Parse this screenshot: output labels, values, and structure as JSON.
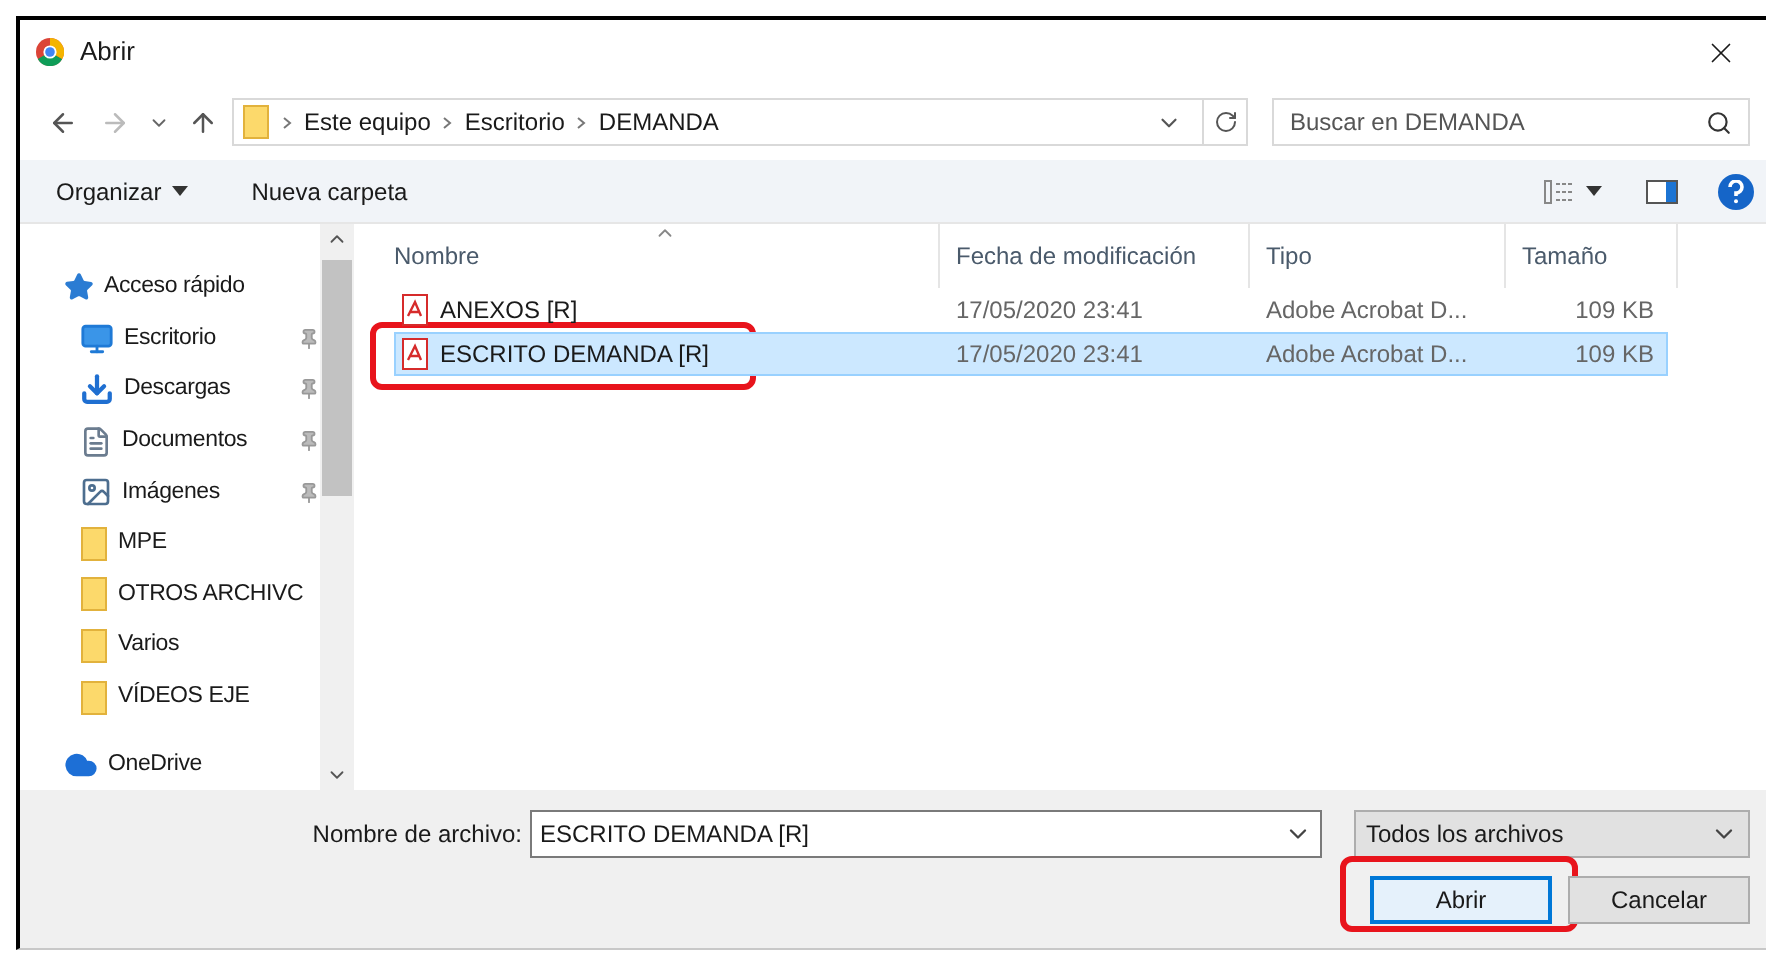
{
  "window": {
    "title": "Abrir"
  },
  "address_bar": {
    "path": [
      "Este equipo",
      "Escritorio",
      "DEMANDA"
    ]
  },
  "search": {
    "placeholder": "Buscar en DEMANDA"
  },
  "toolbar": {
    "organize": "Organizar",
    "new_folder": "Nueva carpeta"
  },
  "sidebar": {
    "items": [
      {
        "label": "Acceso rápido",
        "kind": "star",
        "pinned": false
      },
      {
        "label": "Escritorio",
        "kind": "desktop",
        "pinned": true
      },
      {
        "label": "Descargas",
        "kind": "download",
        "pinned": true
      },
      {
        "label": "Documentos",
        "kind": "document",
        "pinned": true
      },
      {
        "label": "Imágenes",
        "kind": "image",
        "pinned": true
      },
      {
        "label": "MPE",
        "kind": "folder",
        "pinned": false
      },
      {
        "label": "OTROS ARCHIVC",
        "kind": "folder",
        "pinned": false
      },
      {
        "label": "Varios",
        "kind": "folder",
        "pinned": false
      },
      {
        "label": "VÍDEOS EJE",
        "kind": "folder",
        "pinned": false
      },
      {
        "label": "OneDrive",
        "kind": "cloud",
        "pinned": false
      }
    ]
  },
  "table": {
    "columns": [
      "Nombre",
      "Fecha de modificación",
      "Tipo",
      "Tamaño"
    ],
    "rows": [
      {
        "name": "ANEXOS [R]",
        "date": "17/05/2020 23:41",
        "type": "Adobe Acrobat D...",
        "size": "109 KB",
        "selected": false,
        "highlighted": false
      },
      {
        "name": "ESCRITO DEMANDA [R]",
        "date": "17/05/2020 23:41",
        "type": "Adobe Acrobat D...",
        "size": "109 KB",
        "selected": true,
        "highlighted": true
      }
    ]
  },
  "footer": {
    "filename_label": "Nombre de archivo:",
    "filename_value": "ESCRITO DEMANDA [R]",
    "filter": "Todos los archivos",
    "buttons": [
      {
        "label": "Abrir",
        "default": true,
        "highlighted": true
      },
      {
        "label": "Cancelar",
        "default": false,
        "highlighted": false
      }
    ]
  }
}
